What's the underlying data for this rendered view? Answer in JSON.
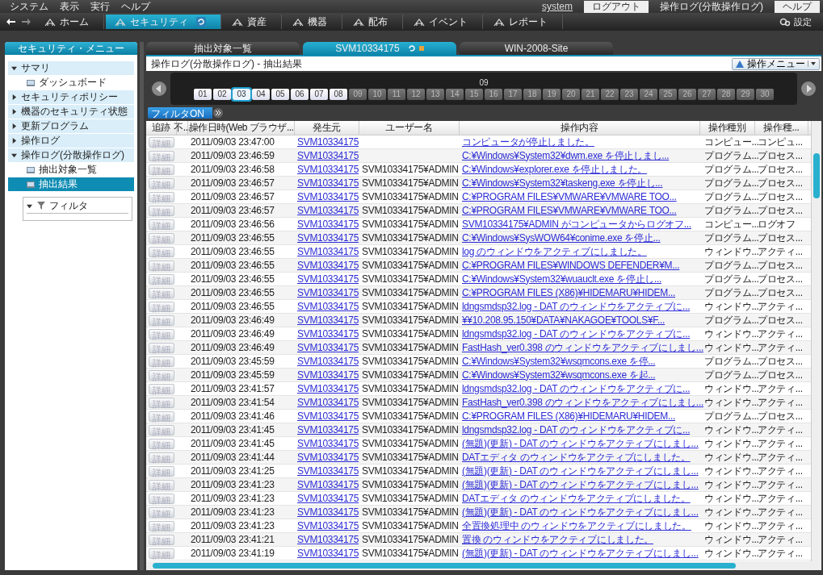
{
  "menu_bar": {
    "items": [
      "システム",
      "表示",
      "実行",
      "ヘルプ"
    ],
    "user_link": "system",
    "logout_button": "ログアウト",
    "context": "操作ログ(分散操作ログ)",
    "help_button": "ヘルプ"
  },
  "toolbar": {
    "items": [
      {
        "label": "ホーム",
        "selected": false
      },
      {
        "label": "セキュリティ",
        "selected": true
      },
      {
        "label": "資産",
        "selected": false
      },
      {
        "label": "機器",
        "selected": false
      },
      {
        "label": "配布",
        "selected": false
      },
      {
        "label": "イベント",
        "selected": false
      },
      {
        "label": "レポート",
        "selected": false
      }
    ],
    "settings": "設定"
  },
  "sidebar": {
    "title": "セキュリティ・メニュー",
    "items": [
      {
        "label": "サマリ",
        "expanded": true,
        "selected": false,
        "children": [
          {
            "label": "ダッシュボード",
            "selected": false
          }
        ]
      },
      {
        "label": "セキュリティポリシー",
        "expanded": false,
        "selected": false
      },
      {
        "label": "機器のセキュリティ状態",
        "expanded": false,
        "selected": false
      },
      {
        "label": "更新プログラム",
        "expanded": false,
        "selected": false
      },
      {
        "label": "操作ログ",
        "expanded": false,
        "selected": false
      },
      {
        "label": "操作ログ(分散操作ログ)",
        "expanded": true,
        "selected": false,
        "children": [
          {
            "label": "抽出対象一覧",
            "selected": false
          },
          {
            "label": "抽出結果",
            "selected": true
          }
        ]
      }
    ],
    "filter": {
      "label": "フィルタ",
      "expanded": true
    }
  },
  "tabs": [
    {
      "label": "抽出対象一覧",
      "selected": false
    },
    {
      "label": "SVM10334175",
      "selected": true
    },
    {
      "label": "WIN-2008-Site",
      "selected": false
    }
  ],
  "page_title": "操作ログ(分散操作ログ) - 抽出結果",
  "operation_menu": "操作メニュー",
  "calendar": {
    "month": "09",
    "days": [
      {
        "label": "01",
        "has_data": true,
        "selected": false
      },
      {
        "label": "02",
        "has_data": true,
        "selected": false
      },
      {
        "label": "03",
        "has_data": true,
        "selected": true
      },
      {
        "label": "04",
        "has_data": true,
        "selected": false
      },
      {
        "label": "05",
        "has_data": true,
        "selected": false
      },
      {
        "label": "06",
        "has_data": true,
        "selected": false
      },
      {
        "label": "07",
        "has_data": true,
        "selected": false
      },
      {
        "label": "08",
        "has_data": true,
        "selected": false
      },
      {
        "label": "09",
        "has_data": false,
        "selected": false
      },
      {
        "label": "10",
        "has_data": false,
        "selected": false
      },
      {
        "label": "11",
        "has_data": false,
        "selected": false
      },
      {
        "label": "12",
        "has_data": false,
        "selected": false
      },
      {
        "label": "13",
        "has_data": false,
        "selected": false
      },
      {
        "label": "14",
        "has_data": false,
        "selected": false
      },
      {
        "label": "15",
        "has_data": false,
        "selected": false
      },
      {
        "label": "16",
        "has_data": false,
        "selected": false
      },
      {
        "label": "17",
        "has_data": false,
        "selected": false
      },
      {
        "label": "18",
        "has_data": false,
        "selected": false
      },
      {
        "label": "19",
        "has_data": false,
        "selected": false
      },
      {
        "label": "20",
        "has_data": false,
        "selected": false
      },
      {
        "label": "21",
        "has_data": false,
        "selected": false
      },
      {
        "label": "22",
        "has_data": false,
        "selected": false
      },
      {
        "label": "23",
        "has_data": false,
        "selected": false
      },
      {
        "label": "24",
        "has_data": false,
        "selected": false
      },
      {
        "label": "25",
        "has_data": false,
        "selected": false
      },
      {
        "label": "26",
        "has_data": false,
        "selected": false
      },
      {
        "label": "27",
        "has_data": false,
        "selected": false
      },
      {
        "label": "28",
        "has_data": false,
        "selected": false
      },
      {
        "label": "29",
        "has_data": false,
        "selected": false
      },
      {
        "label": "30",
        "has_data": false,
        "selected": false
      }
    ]
  },
  "filter_button": "フィルタON",
  "table": {
    "columns": [
      "追跡",
      "不...",
      "操作日時(Web ブラウザ...",
      "発生元",
      "ユーザー名",
      "操作内容",
      "操作種別",
      "操作種..."
    ],
    "rows": [
      {
        "button": "詳細",
        "datetime": "2011/09/03 23:47:00",
        "source": "SVM10334175",
        "content": "コンピュータが停止しました。",
        "type": "コンピュー...",
        "subtype": "コンピュ..."
      },
      {
        "button": "詳細",
        "datetime": "2011/09/03 23:46:59",
        "source": "SVM10334175",
        "content": "C:¥Windows¥System32¥dwm.exe を停止しまし...",
        "type": "プログラム...",
        "subtype": "プロセス..."
      },
      {
        "button": "詳細",
        "datetime": "2011/09/03 23:46:58",
        "source": "SVM10334175",
        "user": "SVM10334175¥ADMIN",
        "content": "C:¥Windows¥explorer.exe を停止しました。",
        "type": "プログラム...",
        "subtype": "プロセス..."
      },
      {
        "button": "詳細",
        "datetime": "2011/09/03 23:46:57",
        "source": "SVM10334175",
        "user": "SVM10334175¥ADMIN",
        "content": "C:¥Windows¥System32¥taskeng.exe を停止し...",
        "type": "プログラム...",
        "subtype": "プロセス..."
      },
      {
        "button": "詳細",
        "datetime": "2011/09/03 23:46:57",
        "source": "SVM10334175",
        "user": "SVM10334175¥ADMIN",
        "content": "C:¥PROGRAM FILES¥VMWARE¥VMWARE TOO...",
        "type": "プログラム...",
        "subtype": "プロセス..."
      },
      {
        "button": "詳細",
        "datetime": "2011/09/03 23:46:57",
        "source": "SVM10334175",
        "user": "SVM10334175¥ADMIN",
        "content": "C:¥PROGRAM FILES¥VMWARE¥VMWARE TOO...",
        "type": "プログラム...",
        "subtype": "プロセス..."
      },
      {
        "button": "詳細",
        "datetime": "2011/09/03 23:46:56",
        "source": "SVM10334175",
        "user": "SVM10334175¥ADMIN",
        "content": "SVM10334175¥ADMIN がコンピュータからログオフ...",
        "type": "コンピュー...",
        "subtype": "ログオフ"
      },
      {
        "button": "詳細",
        "datetime": "2011/09/03 23:46:55",
        "source": "SVM10334175",
        "user": "SVM10334175¥ADMIN",
        "content": "C:¥Windows¥SysWOW64¥conime.exe を停止...",
        "type": "プログラム...",
        "subtype": "プロセス..."
      },
      {
        "button": "詳細",
        "datetime": "2011/09/03 23:46:55",
        "source": "SVM10334175",
        "user": "SVM10334175¥ADMIN",
        "content": "log のウィンドウをアクティブにしました。",
        "type": "ウィンドウ...",
        "subtype": "アクティ..."
      },
      {
        "button": "詳細",
        "datetime": "2011/09/03 23:46:55",
        "source": "SVM10334175",
        "user": "SVM10334175¥ADMIN",
        "content": "C:¥PROGRAM FILES¥WINDOWS DEFENDER¥M...",
        "type": "プログラム...",
        "subtype": "プロセス..."
      },
      {
        "button": "詳細",
        "datetime": "2011/09/03 23:46:55",
        "source": "SVM10334175",
        "user": "SVM10334175¥ADMIN",
        "content": "C:¥Windows¥System32¥wuauclt.exe を停止し...",
        "type": "プログラム...",
        "subtype": "プロセス..."
      },
      {
        "button": "詳細",
        "datetime": "2011/09/03 23:46:55",
        "source": "SVM10334175",
        "user": "SVM10334175¥ADMIN",
        "content": "C:¥PROGRAM FILES (X86)¥HIDEMARU¥HIDEM...",
        "type": "プログラム...",
        "subtype": "プロセス..."
      },
      {
        "button": "詳細",
        "datetime": "2011/09/03 23:46:55",
        "source": "SVM10334175",
        "user": "SVM10334175¥ADMIN",
        "content": "ldngsmdsp32.log - DAT のウィンドウをアクティブに...",
        "type": "ウィンドウ...",
        "subtype": "アクティ..."
      },
      {
        "button": "詳細",
        "datetime": "2011/09/03 23:46:49",
        "source": "SVM10334175",
        "user": "SVM10334175¥ADMIN",
        "content": "¥¥10.208.95.150¥DATA¥NAKAGOE¥TOOLS¥F...",
        "type": "プログラム...",
        "subtype": "プロセス..."
      },
      {
        "button": "詳細",
        "datetime": "2011/09/03 23:46:49",
        "source": "SVM10334175",
        "user": "SVM10334175¥ADMIN",
        "content": "ldngsmdsp32.log - DAT のウィンドウをアクティブに...",
        "type": "ウィンドウ...",
        "subtype": "アクティ..."
      },
      {
        "button": "詳細",
        "datetime": "2011/09/03 23:46:49",
        "source": "SVM10334175",
        "user": "SVM10334175¥ADMIN",
        "content": "FastHash_ver0.398 のウィンドウをアクティブにしまし...",
        "type": "ウィンドウ...",
        "subtype": "アクティ..."
      },
      {
        "button": "詳細",
        "datetime": "2011/09/03 23:45:59",
        "source": "SVM10334175",
        "user": "SVM10334175¥ADMIN",
        "content": "C:¥Windows¥System32¥wsqmcons.exe を停...",
        "type": "プログラム...",
        "subtype": "プロセス..."
      },
      {
        "button": "詳細",
        "datetime": "2011/09/03 23:45:59",
        "source": "SVM10334175",
        "user": "SVM10334175¥ADMIN",
        "content": "C:¥Windows¥System32¥wsqmcons.exe を起...",
        "type": "プログラム...",
        "subtype": "プロセス..."
      },
      {
        "button": "詳細",
        "datetime": "2011/09/03 23:41:57",
        "source": "SVM10334175",
        "user": "SVM10334175¥ADMIN",
        "content": "ldngsmdsp32.log - DAT のウィンドウをアクティブに...",
        "type": "ウィンドウ...",
        "subtype": "アクティ..."
      },
      {
        "button": "詳細",
        "datetime": "2011/09/03 23:41:54",
        "source": "SVM10334175",
        "user": "SVM10334175¥ADMIN",
        "content": "FastHash_ver0.398 のウィンドウをアクティブにしまし...",
        "type": "ウィンドウ...",
        "subtype": "アクティ..."
      },
      {
        "button": "詳細",
        "datetime": "2011/09/03 23:41:46",
        "source": "SVM10334175",
        "user": "SVM10334175¥ADMIN",
        "content": "C:¥PROGRAM FILES (X86)¥HIDEMARU¥HIDEM...",
        "type": "プログラム...",
        "subtype": "プロセス..."
      },
      {
        "button": "詳細",
        "datetime": "2011/09/03 23:41:45",
        "source": "SVM10334175",
        "user": "SVM10334175¥ADMIN",
        "content": "ldngsmdsp32.log - DAT のウィンドウをアクティブに...",
        "type": "ウィンドウ...",
        "subtype": "アクティ..."
      },
      {
        "button": "詳細",
        "datetime": "2011/09/03 23:41:45",
        "source": "SVM10334175",
        "user": "SVM10334175¥ADMIN",
        "content": "(無題)(更新) - DAT のウィンドウをアクティブにしまし...",
        "type": "ウィンドウ...",
        "subtype": "アクティ..."
      },
      {
        "button": "詳細",
        "datetime": "2011/09/03 23:41:44",
        "source": "SVM10334175",
        "user": "SVM10334175¥ADMIN",
        "content": "DATエディタ のウィンドウをアクティブにしました。",
        "type": "ウィンドウ...",
        "subtype": "アクティ..."
      },
      {
        "button": "詳細",
        "datetime": "2011/09/03 23:41:25",
        "source": "SVM10334175",
        "user": "SVM10334175¥ADMIN",
        "content": "(無題)(更新) - DAT のウィンドウをアクティブにしまし...",
        "type": "ウィンドウ...",
        "subtype": "アクティ..."
      },
      {
        "button": "詳細",
        "datetime": "2011/09/03 23:41:23",
        "source": "SVM10334175",
        "user": "SVM10334175¥ADMIN",
        "content": "(無題)(更新) - DAT のウィンドウをアクティブにしまし...",
        "type": "ウィンドウ...",
        "subtype": "アクティ..."
      },
      {
        "button": "詳細",
        "datetime": "2011/09/03 23:41:23",
        "source": "SVM10334175",
        "user": "SVM10334175¥ADMIN",
        "content": "DATエディタ のウィンドウをアクティブにしました。",
        "type": "ウィンドウ...",
        "subtype": "アクティ..."
      },
      {
        "button": "詳細",
        "datetime": "2011/09/03 23:41:23",
        "source": "SVM10334175",
        "user": "SVM10334175¥ADMIN",
        "content": "(無題)(更新) - DAT のウィンドウをアクティブにしまし...",
        "type": "ウィンドウ...",
        "subtype": "アクティ..."
      },
      {
        "button": "詳細",
        "datetime": "2011/09/03 23:41:23",
        "source": "SVM10334175",
        "user": "SVM10334175¥ADMIN",
        "content": "全置換処理中 のウィンドウをアクティブにしました。",
        "type": "ウィンドウ...",
        "subtype": "アクティ..."
      },
      {
        "button": "詳細",
        "datetime": "2011/09/03 23:41:21",
        "source": "SVM10334175",
        "user": "SVM10334175¥ADMIN",
        "content": "置換 のウィンドウをアクティブにしました。",
        "type": "ウィンドウ...",
        "subtype": "アクティ..."
      },
      {
        "button": "詳細",
        "datetime": "2011/09/03 23:41:19",
        "source": "SVM10334175",
        "user": "SVM10334175¥ADMIN",
        "content": "(無題)(更新) - DAT のウィンドウをアクティブにしまし...",
        "type": "ウィンドウ...",
        "subtype": "アクティ..."
      }
    ]
  }
}
